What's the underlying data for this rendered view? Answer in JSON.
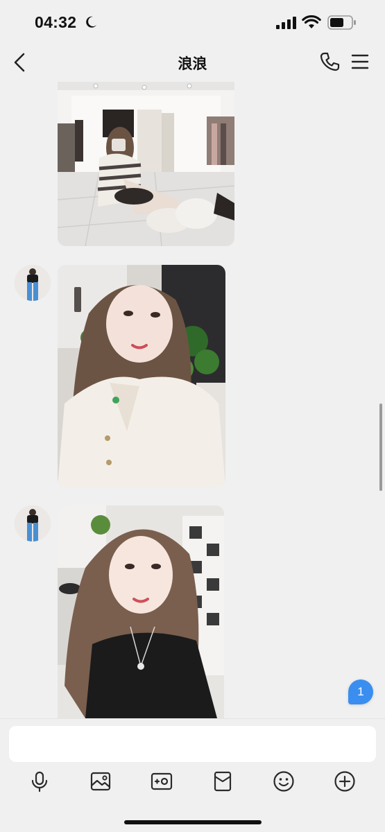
{
  "status_bar": {
    "time": "04:32",
    "icons": [
      "moon-icon",
      "signal-icon",
      "wifi-icon",
      "battery-icon"
    ]
  },
  "nav": {
    "title": "浪浪",
    "icons": [
      "back-icon",
      "phone-icon",
      "menu-icon"
    ]
  },
  "chat": {
    "messages": [
      {
        "type": "image",
        "content": "photo"
      },
      {
        "type": "image",
        "content": "photo"
      },
      {
        "type": "image",
        "content": "photo"
      }
    ],
    "unread_count": "1"
  },
  "input_bar": {
    "placeholder": "",
    "tools": [
      "microphone-icon",
      "image-icon",
      "camera-icon",
      "red-packet-icon",
      "emoji-icon",
      "plus-icon"
    ]
  },
  "colors": {
    "background": "#f0f0f0",
    "accent": "#3a8ef0"
  }
}
